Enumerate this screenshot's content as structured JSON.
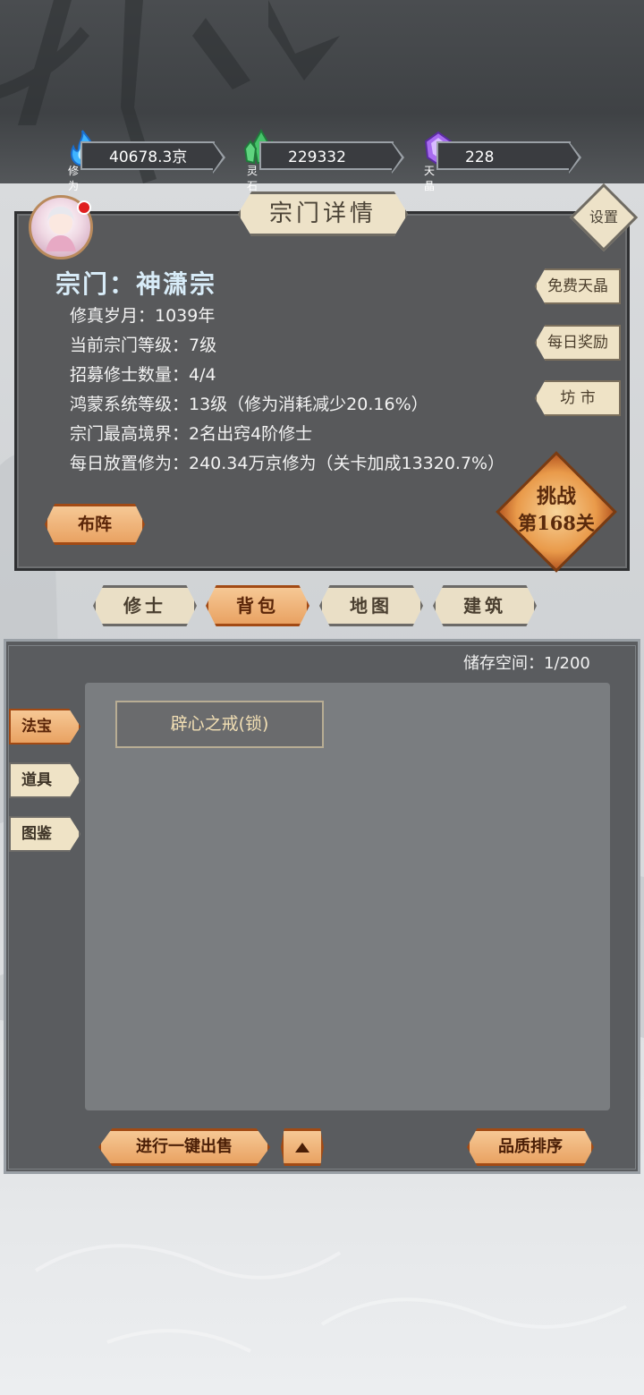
{
  "resources": [
    {
      "label": "修为",
      "value": "40678.3京",
      "icon": "blue-flame-icon",
      "color": "#3fb4ff"
    },
    {
      "label": "灵石",
      "value": "229332",
      "icon": "green-crystal-icon",
      "color": "#46c46a"
    },
    {
      "label": "天晶",
      "value": "228",
      "icon": "purple-crystal-icon",
      "color": "#a86cf0"
    }
  ],
  "panel": {
    "title": "宗门详情",
    "settings_label": "设置",
    "sect_name": "宗门：神潇宗",
    "info": [
      "修真岁月：1039年",
      "当前宗门等级：7级",
      "招募修士数量：4/4",
      "鸿蒙系统等级：13级（修为消耗减少20.16%）",
      "宗门最高境界：2名出窍4阶修士",
      "每日放置修为：240.34万京修为（关卡加成13320.7%）"
    ],
    "side_buttons": [
      "免费天晶",
      "每日奖励",
      "坊 市"
    ],
    "challenge_line1": "挑战",
    "challenge_line2": "第168关",
    "formation_button": "布阵"
  },
  "tabs": [
    {
      "label": "修士",
      "active": false
    },
    {
      "label": "背包",
      "active": true
    },
    {
      "label": "地图",
      "active": false
    },
    {
      "label": "建筑",
      "active": false
    }
  ],
  "inventory": {
    "storage": "储存空间：1/200",
    "categories": [
      {
        "label": "法宝",
        "active": true
      },
      {
        "label": "道具",
        "active": false
      },
      {
        "label": "图鉴",
        "active": false
      }
    ],
    "items": [
      "辟心之戒(锁)"
    ],
    "sell_button": "进行一键出售",
    "sort_button": "品质排序"
  },
  "colors": {
    "accent_orange": "#e9a262",
    "panel_bg": "#58595b",
    "parchment": "#efe3c6"
  }
}
